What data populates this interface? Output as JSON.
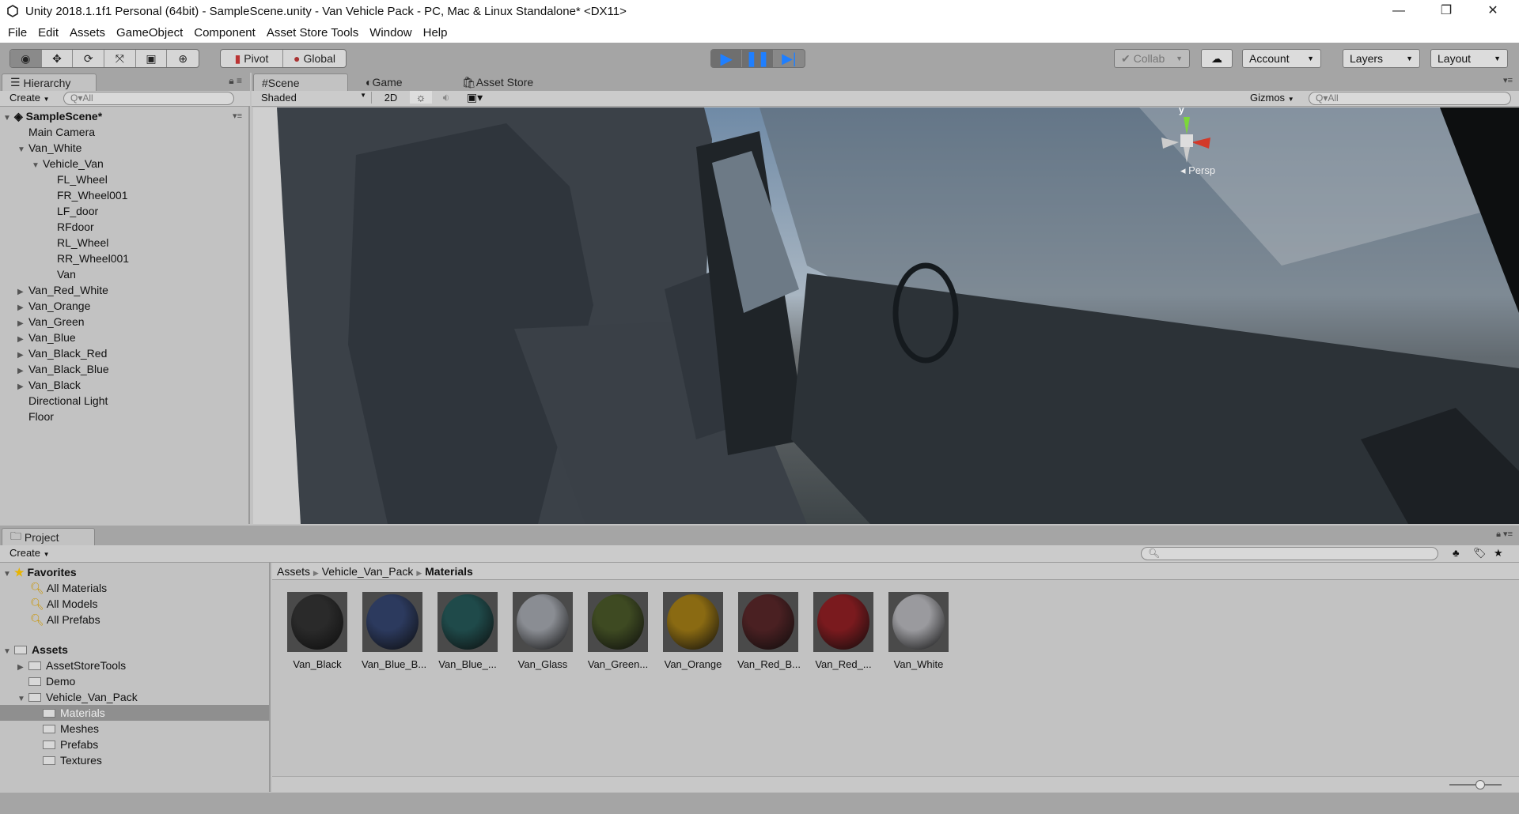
{
  "window": {
    "title": "Unity 2018.1.1f1 Personal (64bit) - SampleScene.unity - Van Vehicle Pack - PC, Mac & Linux Standalone* <DX11>",
    "minimize": "—",
    "maximize": "❐",
    "close": "✕"
  },
  "menu": [
    "File",
    "Edit",
    "Assets",
    "GameObject",
    "Component",
    "Asset Store Tools",
    "Window",
    "Help"
  ],
  "toolbar": {
    "pivot": "Pivot",
    "global": "Global",
    "collab": "Collab",
    "account": "Account",
    "layers": "Layers",
    "layout": "Layout"
  },
  "hierarchy": {
    "tab": "Hierarchy",
    "create": "Create",
    "search_placeholder": "All",
    "scene": "SampleScene*",
    "items": [
      {
        "label": "Main Camera",
        "depth": 0,
        "arrow": ""
      },
      {
        "label": "Van_White",
        "depth": 0,
        "arrow": "▼"
      },
      {
        "label": "Vehicle_Van",
        "depth": 1,
        "arrow": "▼"
      },
      {
        "label": "FL_Wheel",
        "depth": 2,
        "arrow": ""
      },
      {
        "label": "FR_Wheel001",
        "depth": 2,
        "arrow": ""
      },
      {
        "label": "LF_door",
        "depth": 2,
        "arrow": ""
      },
      {
        "label": "RFdoor",
        "depth": 2,
        "arrow": ""
      },
      {
        "label": "RL_Wheel",
        "depth": 2,
        "arrow": ""
      },
      {
        "label": "RR_Wheel001",
        "depth": 2,
        "arrow": ""
      },
      {
        "label": "Van",
        "depth": 2,
        "arrow": ""
      },
      {
        "label": "Van_Red_White",
        "depth": 0,
        "arrow": "▶"
      },
      {
        "label": "Van_Orange",
        "depth": 0,
        "arrow": "▶"
      },
      {
        "label": "Van_Green",
        "depth": 0,
        "arrow": "▶"
      },
      {
        "label": "Van_Blue",
        "depth": 0,
        "arrow": "▶"
      },
      {
        "label": "Van_Black_Red",
        "depth": 0,
        "arrow": "▶"
      },
      {
        "label": "Van_Black_Blue",
        "depth": 0,
        "arrow": "▶"
      },
      {
        "label": "Van_Black",
        "depth": 0,
        "arrow": "▶"
      },
      {
        "label": "Directional Light",
        "depth": 0,
        "arrow": ""
      },
      {
        "label": "Floor",
        "depth": 0,
        "arrow": ""
      }
    ]
  },
  "scene": {
    "tabs": [
      "Scene",
      "Game",
      "Asset Store"
    ],
    "shading": "Shaded",
    "mode2d": "2D",
    "gizmos": "Gizmos",
    "search_placeholder": "All",
    "gizmo_axis": "y",
    "projection": "Persp"
  },
  "project": {
    "tab": "Project",
    "create": "Create",
    "favorites": {
      "label": "Favorites",
      "items": [
        "All Materials",
        "All Models",
        "All Prefabs"
      ]
    },
    "assets": {
      "label": "Assets",
      "items": [
        {
          "label": "AssetStoreTools",
          "depth": 1,
          "arrow": "▶"
        },
        {
          "label": "Demo",
          "depth": 1,
          "arrow": ""
        },
        {
          "label": "Vehicle_Van_Pack",
          "depth": 1,
          "arrow": "▼"
        },
        {
          "label": "Materials",
          "depth": 2,
          "arrow": "",
          "selected": true
        },
        {
          "label": "Meshes",
          "depth": 2,
          "arrow": ""
        },
        {
          "label": "Prefabs",
          "depth": 2,
          "arrow": ""
        },
        {
          "label": "Textures",
          "depth": 2,
          "arrow": ""
        }
      ]
    },
    "breadcrumb": [
      "Assets",
      "Vehicle_Van_Pack",
      "Materials"
    ],
    "materials": [
      {
        "label": "Van_Black",
        "color": "#2a2a2a"
      },
      {
        "label": "Van_Blue_B...",
        "color": "#2c3a5e"
      },
      {
        "label": "Van_Blue_...",
        "color": "#1f4a4a"
      },
      {
        "label": "Van_Glass",
        "color": "#8a8d93"
      },
      {
        "label": "Van_Green...",
        "color": "#3e4a22"
      },
      {
        "label": "Van_Orange",
        "color": "#8a6a12"
      },
      {
        "label": "Van_Red_B...",
        "color": "#4a2022"
      },
      {
        "label": "Van_Red_...",
        "color": "#7a1a1e"
      },
      {
        "label": "Van_White",
        "color": "#9a9a9e"
      }
    ]
  },
  "colors": {
    "play": "#1f7fff",
    "panel": "#c2c2c2"
  }
}
